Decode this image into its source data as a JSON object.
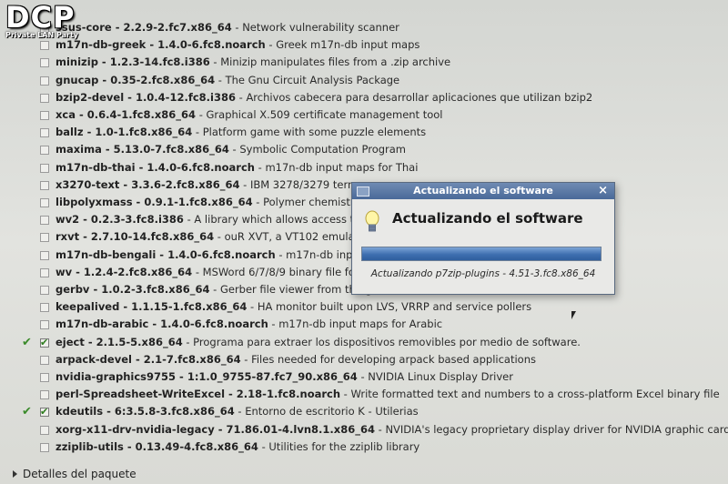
{
  "watermark": {
    "title": "DCP",
    "subtitle": "Private LAN Party"
  },
  "packages": [
    {
      "name": "ssus-core",
      "version": "2.2.9-2.fc7.x86_64",
      "desc": "Network vulnerability scanner",
      "checked": false,
      "installed": false
    },
    {
      "name": "m17n-db-greek",
      "version": "1.4.0-6.fc8.noarch",
      "desc": "Greek m17n-db input maps",
      "checked": false,
      "installed": false
    },
    {
      "name": "minizip",
      "version": "1.2.3-14.fc8.i386",
      "desc": "Minizip manipulates files from a .zip archive",
      "checked": false,
      "installed": false
    },
    {
      "name": "gnucap",
      "version": "0.35-2.fc8.x86_64",
      "desc": "The Gnu Circuit Analysis Package",
      "checked": false,
      "installed": false
    },
    {
      "name": "bzip2-devel",
      "version": "1.0.4-12.fc8.i386",
      "desc": "Archivos cabecera para desarrollar aplicaciones que utilizan bzip2",
      "checked": false,
      "installed": false
    },
    {
      "name": "xca",
      "version": "0.6.4-1.fc8.x86_64",
      "desc": "Graphical X.509 certificate management tool",
      "checked": false,
      "installed": false
    },
    {
      "name": "ballz",
      "version": "1.0-1.fc8.x86_64",
      "desc": "Platform game with some puzzle elements",
      "checked": false,
      "installed": false
    },
    {
      "name": "maxima",
      "version": "5.13.0-7.fc8.x86_64",
      "desc": "Symbolic Computation Program",
      "checked": false,
      "installed": false
    },
    {
      "name": "m17n-db-thai",
      "version": "1.4.0-6.fc8.noarch",
      "desc": "m17n-db input maps for Thai",
      "checked": false,
      "installed": false
    },
    {
      "name": "x3270-text",
      "version": "3.3.6-2.fc8.x86_64",
      "desc": "IBM 3278/3279 term",
      "checked": false,
      "installed": false
    },
    {
      "name": "libpolyxmass",
      "version": "0.9.1-1.fc8.x86_64",
      "desc": "Polymer chemistr",
      "checked": false,
      "installed": false
    },
    {
      "name": "wv2",
      "version": "0.2.3-3.fc8.i386",
      "desc": "A library which allows access to",
      "checked": false,
      "installed": false
    },
    {
      "name": "rxvt",
      "version": "2.7.10-14.fc8.x86_64",
      "desc": "ouR XVT, a VT102 emulat",
      "checked": false,
      "installed": false
    },
    {
      "name": "m17n-db-bengali",
      "version": "1.4.0-6.fc8.noarch",
      "desc": "m17n-db inpu",
      "checked": false,
      "installed": false
    },
    {
      "name": "wv",
      "version": "1.2.4-2.fc8.x86_64",
      "desc": "MSWord 6/7/8/9 binary file forn",
      "checked": false,
      "installed": false
    },
    {
      "name": "gerbv",
      "version": "1.0.2-3.fc8.x86_64",
      "desc": "Gerber file viewer from the gEDA toolkit",
      "checked": false,
      "installed": false
    },
    {
      "name": "keepalived",
      "version": "1.1.15-1.fc8.x86_64",
      "desc": "HA monitor built upon LVS, VRRP and service pollers",
      "checked": false,
      "installed": false
    },
    {
      "name": "m17n-db-arabic",
      "version": "1.4.0-6.fc8.noarch",
      "desc": "m17n-db input maps for Arabic",
      "checked": false,
      "installed": false
    },
    {
      "name": "eject",
      "version": "2.1.5-5.x86_64",
      "desc": "Programa para extraer los dispositivos removibles por medio de software.",
      "checked": true,
      "installed": true
    },
    {
      "name": "arpack-devel",
      "version": "2.1-7.fc8.x86_64",
      "desc": "Files needed for developing arpack based applications",
      "checked": false,
      "installed": false
    },
    {
      "name": "nvidia-graphics9755",
      "version": "1:1.0_9755-87.fc7_90.x86_64",
      "desc": "NVIDIA Linux Display Driver",
      "checked": false,
      "installed": false
    },
    {
      "name": "perl-Spreadsheet-WriteExcel",
      "version": "2.18-1.fc8.noarch",
      "desc": "Write formatted text and numbers to a cross-platform Excel binary file",
      "checked": false,
      "installed": false
    },
    {
      "name": "kdeutils",
      "version": "6:3.5.8-3.fc8.x86_64",
      "desc": "Entorno de escritorio K - Utilerias",
      "checked": true,
      "installed": true
    },
    {
      "name": "xorg-x11-drv-nvidia-legacy",
      "version": "71.86.01-4.lvn8.1.x86_64",
      "desc": "NVIDIA's legacy proprietary display driver for NVIDIA graphic cards",
      "checked": false,
      "installed": false
    },
    {
      "name": "zziplib-utils",
      "version": "0.13.49-4.fc8.x86_64",
      "desc": "Utilities for the zziplib library",
      "checked": false,
      "installed": false
    }
  ],
  "footer": {
    "details_label": "Detalles del paquete"
  },
  "dialog": {
    "window_title": "Actualizando el software",
    "close_glyph": "×",
    "heading": "Actualizando el software",
    "status": "Actualizando p7zip-plugins - 4.51-3.fc8.x86_64",
    "progress": 1.0
  }
}
